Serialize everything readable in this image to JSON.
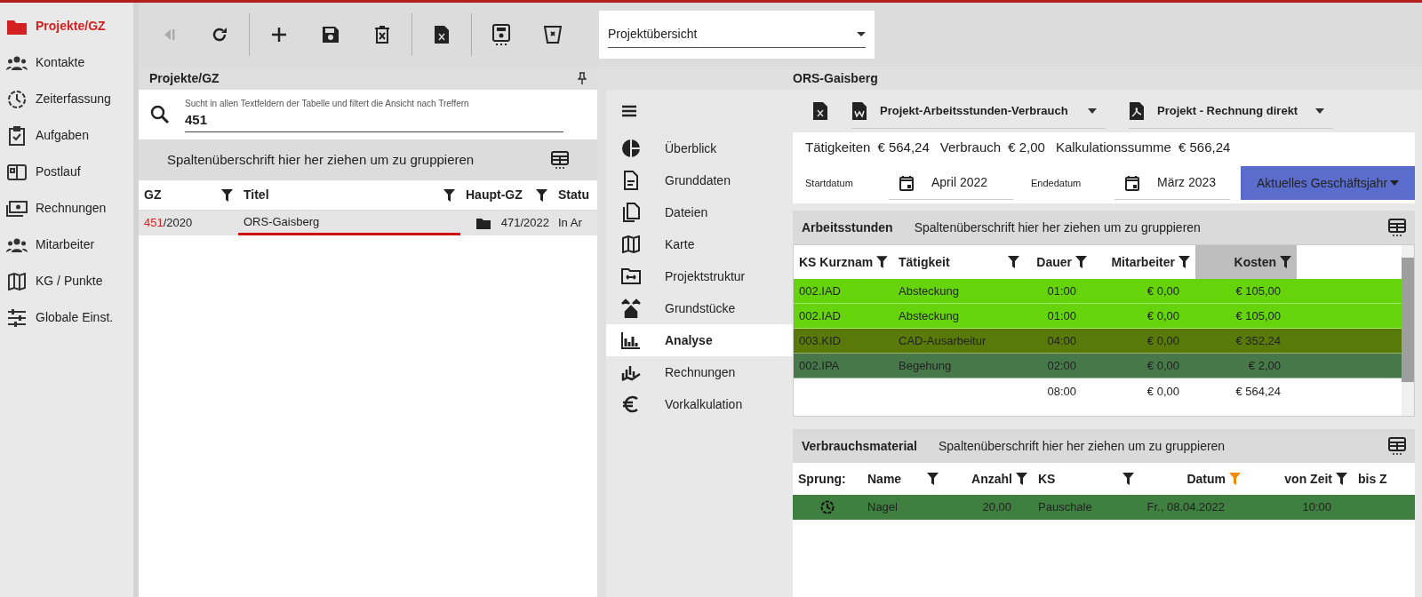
{
  "nav": [
    {
      "label": "Projekte/GZ",
      "selected": true
    },
    {
      "label": "Kontakte",
      "selected": false
    },
    {
      "label": "Zeiterfassung",
      "selected": false
    },
    {
      "label": "Aufgaben",
      "selected": false
    },
    {
      "label": "Postlauf",
      "selected": false
    },
    {
      "label": "Rechnungen",
      "selected": false
    },
    {
      "label": "Mitarbeiter",
      "selected": false
    },
    {
      "label": "KG / Punkte",
      "selected": false
    },
    {
      "label": "Globale Einst.",
      "selected": false
    }
  ],
  "toolbar": [
    {
      "kind": "back",
      "disabled": true
    },
    {
      "kind": "refresh",
      "disabled": false
    },
    {
      "kind": "sep"
    },
    {
      "kind": "add",
      "disabled": false
    },
    {
      "kind": "save",
      "disabled": false
    },
    {
      "kind": "delete",
      "disabled": false
    },
    {
      "kind": "sep"
    },
    {
      "kind": "excel",
      "disabled": false
    },
    {
      "kind": "sep"
    },
    {
      "kind": "saveview",
      "disabled": false
    },
    {
      "kind": "clearfilter",
      "disabled": false
    }
  ],
  "view_select": {
    "value": "Projektübersicht"
  },
  "left_panel": {
    "title": "Projekte/GZ",
    "search": {
      "placeholder": "Sucht in allen Textfeldern der Tabelle und filtert die Ansicht nach Treffern",
      "value": "451"
    },
    "group_hint": "Spaltenüberschrift hier her ziehen um zu gruppieren",
    "columns": [
      {
        "label": "GZ",
        "filter": true
      },
      {
        "label": "Titel",
        "filter": true
      },
      {
        "label": "Haupt-GZ",
        "filter": true
      },
      {
        "label": "Statu",
        "filter": false
      }
    ],
    "rows": [
      {
        "gz_match": "451",
        "gz_rest": "/2020",
        "title": "ORS-Gaisberg",
        "haupt_gz": "471/2022",
        "status": "In Ar",
        "selected": true
      }
    ]
  },
  "detail": {
    "title": "ORS-Gaisberg",
    "subnav": [
      {
        "label": "Überblick",
        "selected": false
      },
      {
        "label": "Grunddaten",
        "selected": false
      },
      {
        "label": "Dateien",
        "selected": false
      },
      {
        "label": "Karte",
        "selected": false
      },
      {
        "label": "Projektstruktur",
        "selected": false
      },
      {
        "label": "Grundstücke",
        "selected": false
      },
      {
        "label": "Analyse",
        "selected": true
      },
      {
        "label": "Rechnungen",
        "selected": false
      },
      {
        "label": "Vorkalkulation",
        "selected": false
      }
    ],
    "reports": [
      {
        "kind": "word",
        "label": "Projekt-Arbeitsstunden-Verbrauch"
      },
      {
        "kind": "pdf",
        "label": "Projekt - Rechnung direkt"
      }
    ],
    "summary": [
      "Tätigkeiten",
      "€ 564,24",
      "Verbrauch",
      "€ 2,00",
      "Kalkulationssumme",
      "€ 566,24"
    ],
    "start_label": "Startdatum",
    "start": "April 2022",
    "end_label": "Endedatum",
    "end": "März 2023",
    "period_button": "Aktuelles Geschäftsjahr",
    "hours": {
      "title": "Arbeitsstunden",
      "group_hint": "Spaltenüberschrift hier her ziehen um zu gruppieren",
      "columns": [
        {
          "label": "KS Kurznam",
          "sorted": false
        },
        {
          "label": "Tätigkeit",
          "sorted": false
        },
        {
          "label": "Dauer",
          "sorted": false
        },
        {
          "label": "Mitarbeiter",
          "sorted": false
        },
        {
          "label": "Kosten",
          "sorted": true
        }
      ],
      "rows": [
        {
          "cells": [
            "002.IAD",
            "Absteckung",
            "01:00",
            "€ 0,00",
            "€ 105,00"
          ],
          "color": "#66d40a"
        },
        {
          "cells": [
            "002.IAD",
            "Absteckung",
            "01:00",
            "€ 0,00",
            "€ 105,00"
          ],
          "color": "#66d40a"
        },
        {
          "cells": [
            "003.KID",
            "CAD-Ausarbeitur",
            "04:00",
            "€ 0,00",
            "€ 352,24"
          ],
          "color": "#587a08"
        },
        {
          "cells": [
            "002.IPA",
            "Begehung",
            "02:00",
            "€ 0,00",
            "€ 2,00"
          ],
          "color": "#47784a"
        }
      ],
      "totals": [
        "08:00",
        "€ 0,00",
        "€ 564,24"
      ]
    },
    "material": {
      "title": "Verbrauchsmaterial",
      "group_hint": "Spaltenüberschrift hier her ziehen um zu gruppieren",
      "columns": [
        {
          "label": "Sprung:",
          "filter": false,
          "filter_active": false
        },
        {
          "label": "Name",
          "filter": true,
          "filter_active": false
        },
        {
          "label": "Anzahl",
          "filter": true,
          "filter_active": false
        },
        {
          "label": "KS",
          "filter": true,
          "filter_active": false
        },
        {
          "label": "Datum",
          "filter": true,
          "filter_active": true
        },
        {
          "label": "von Zeit",
          "filter": true,
          "filter_active": false
        },
        {
          "label": "bis Z",
          "filter": false,
          "filter_active": false
        }
      ],
      "rows": [
        {
          "cells": [
            "",
            "Nagel",
            "20,00",
            "Pauschale",
            "Fr., 08.04.2022",
            "10:00"
          ],
          "color": "#3f7f3f"
        }
      ]
    }
  }
}
